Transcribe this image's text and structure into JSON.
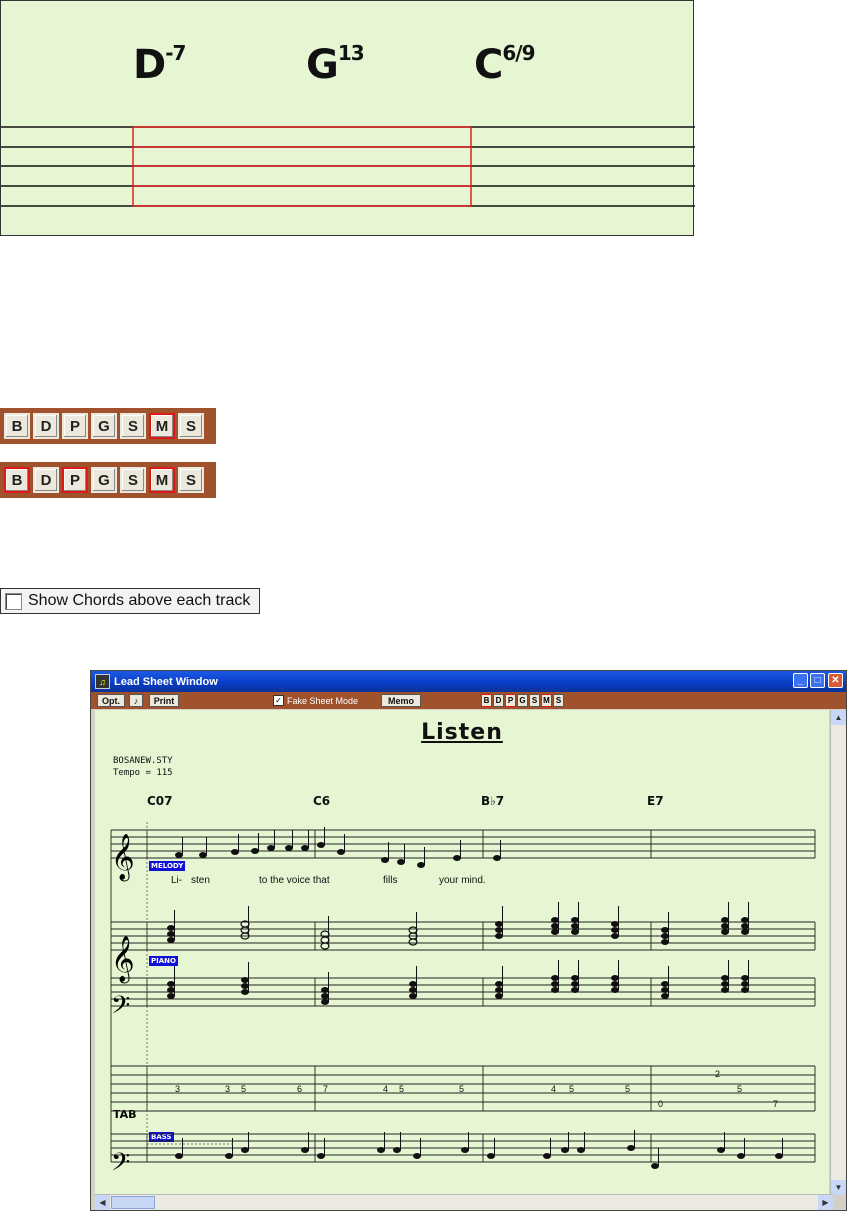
{
  "chord_panel": {
    "chords": [
      {
        "root": "D",
        "ext": "-7"
      },
      {
        "root": "G",
        "ext": "13"
      },
      {
        "root": "C",
        "ext": "6/9"
      }
    ]
  },
  "track_bars": [
    {
      "buttons": [
        "B",
        "D",
        "P",
        "G",
        "S",
        "M",
        "S"
      ],
      "highlighted": [
        5
      ]
    },
    {
      "buttons": [
        "B",
        "D",
        "P",
        "G",
        "S",
        "M",
        "S"
      ],
      "highlighted": [
        0,
        2,
        5
      ]
    }
  ],
  "checkbox": {
    "label": "Show Chords above each track",
    "checked": false
  },
  "window": {
    "title": "Lead Sheet Window",
    "toolbar": {
      "opt_label": "Opt.",
      "note_icon": "♪",
      "print_label": "Print",
      "fake_sheet_label": "Fake Sheet Mode",
      "fake_sheet_checked": true,
      "memo_label": "Memo",
      "tracks": [
        "B",
        "D",
        "P",
        "G",
        "S",
        "M",
        "S"
      ]
    },
    "song_title": "Listen",
    "style_file": "BOSANEW.STY",
    "tempo": "Tempo = 115",
    "chords": [
      "C07",
      "C6",
      "B♭7",
      "E7"
    ],
    "track_labels": {
      "melody": "MELODY",
      "piano": "PIANO",
      "bass": "BASS"
    },
    "lyrics": [
      "Li-",
      "sten",
      "to the voice that",
      "fills",
      "your mind."
    ],
    "tab_label": "TAB",
    "tab_numbers": [
      "3",
      "3",
      "5",
      "6",
      "7",
      "4",
      "5",
      "5",
      "4",
      "5",
      "5",
      "2",
      "0",
      "5",
      "7"
    ]
  }
}
